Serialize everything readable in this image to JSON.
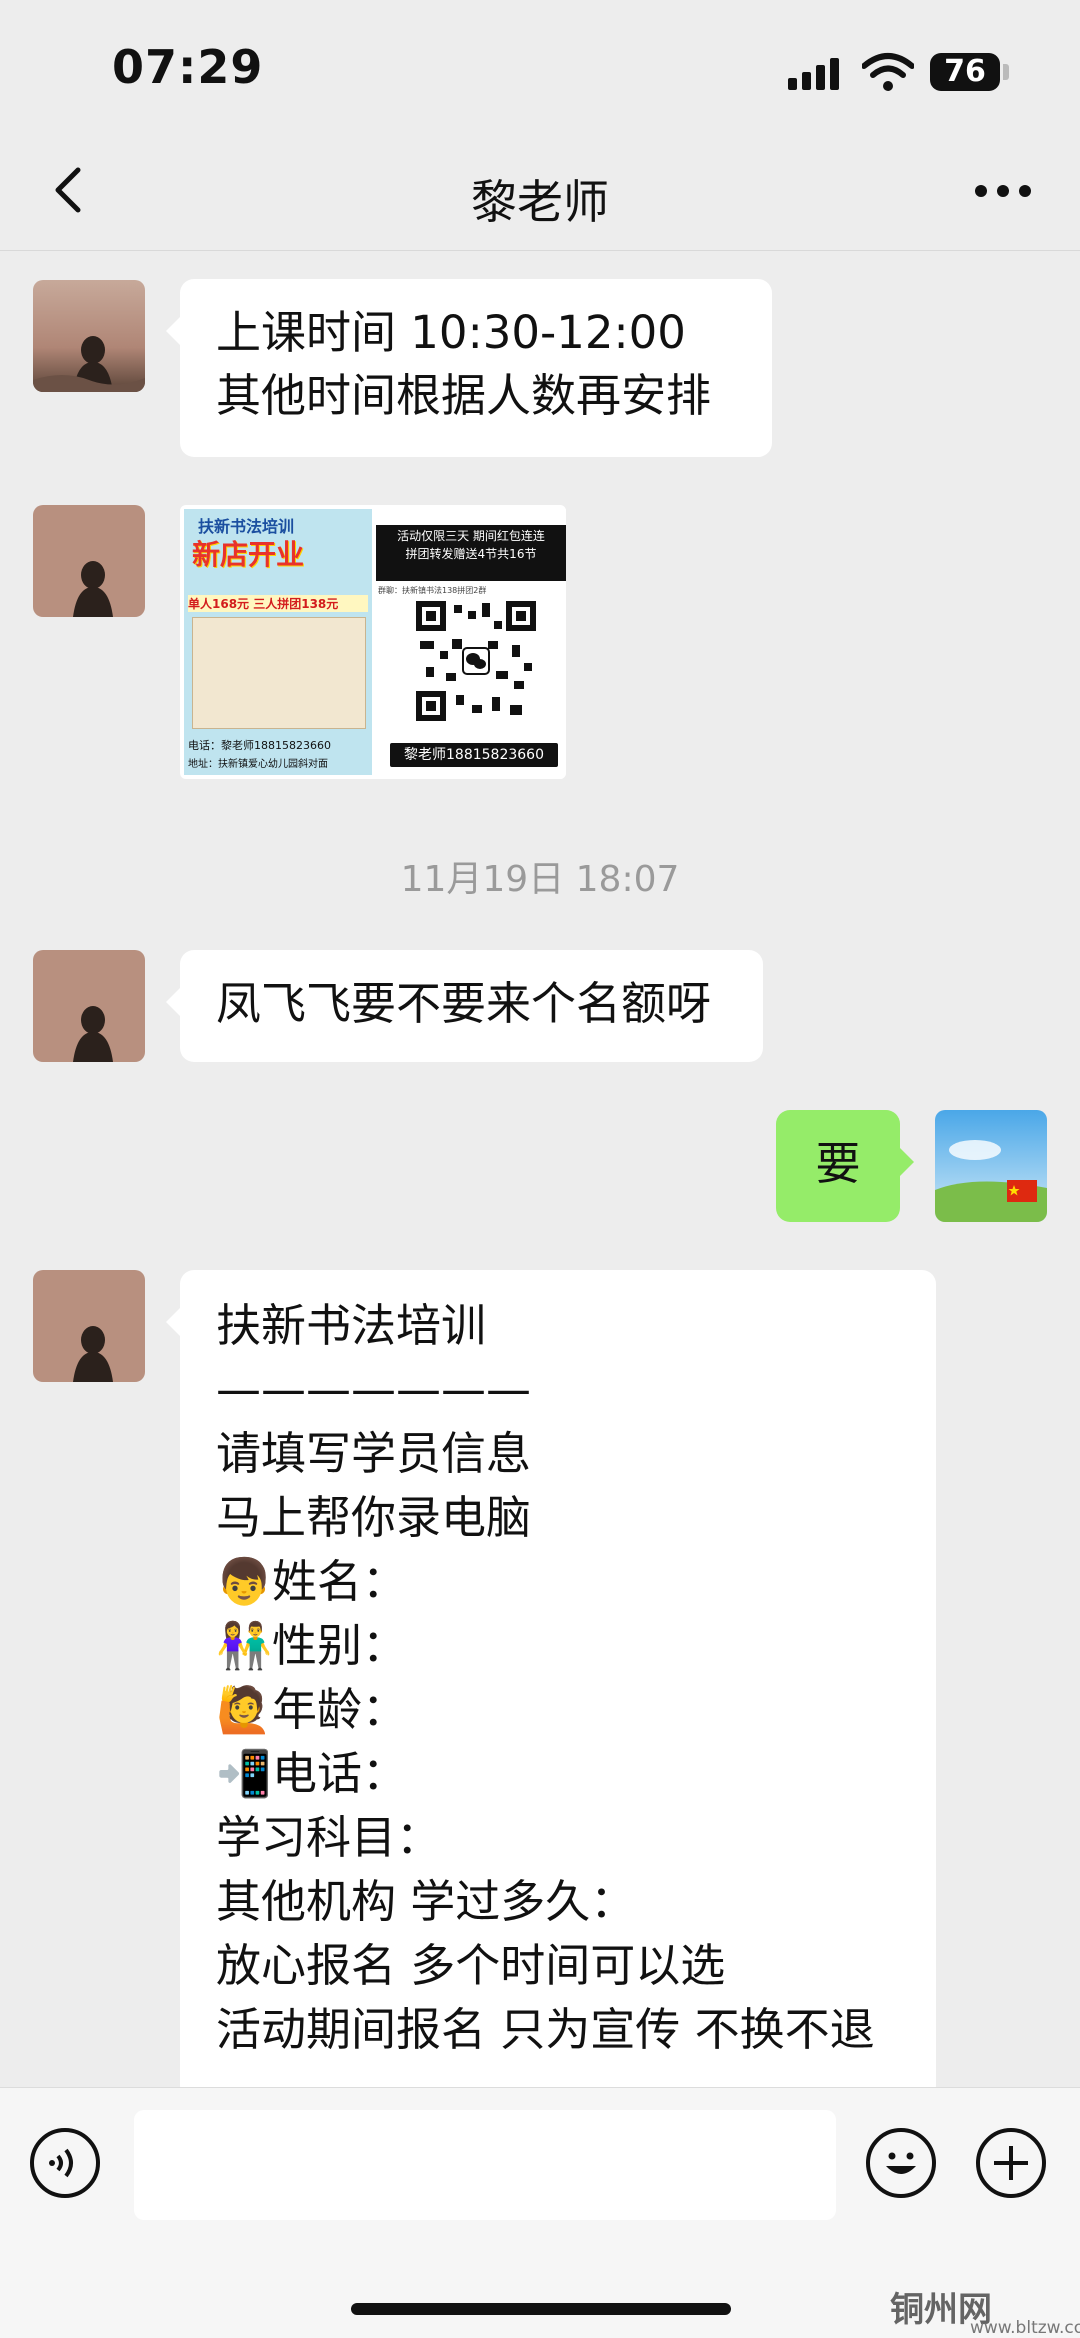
{
  "status_bar": {
    "time": "07:29",
    "battery": "76"
  },
  "header": {
    "title": "黎老师"
  },
  "messages": {
    "m1": "上课时间 10:30-12:00\n 其他时间根据人数再安排",
    "poster": {
      "title": "扶新书法培训",
      "big": "新店开业",
      "price": "单人168元 三人拼团138元",
      "phone": "电话：黎老师18815823660",
      "address": "地址：扶新镇爱心幼儿园斜对面",
      "promo1": "活动仅限三天 期间红包连连",
      "promo2": "拼团转发赠送4节共16节",
      "group": "群聊：扶新镇书法138拼团2群",
      "contact": "黎老师18815823660"
    },
    "timestamp": "11月19日 18:07",
    "m2": "凤飞飞要不要来个名额呀",
    "m3": "要",
    "m4": "扶新书法培训\n———————\n请填写学员信息\n马上帮你录电脑\n👦姓名：\n👫性别：\n🙋年龄：\n📲电话：\n学习科目：\n其他机构 学过多久：\n放心报名 多个时间可以选\n活动期间报名  只为宣传 不换不退"
  },
  "watermark": {
    "text": "铜州网",
    "url": "www.bltzw.com"
  },
  "icons": {
    "back": "chevron-left-icon",
    "more": "more-icon",
    "voice": "voice-icon",
    "emoji": "emoji-icon",
    "add": "add-icon"
  },
  "colors": {
    "bg": "#ededed",
    "self_bubble": "#95ec69",
    "other_bubble": "#ffffff"
  }
}
